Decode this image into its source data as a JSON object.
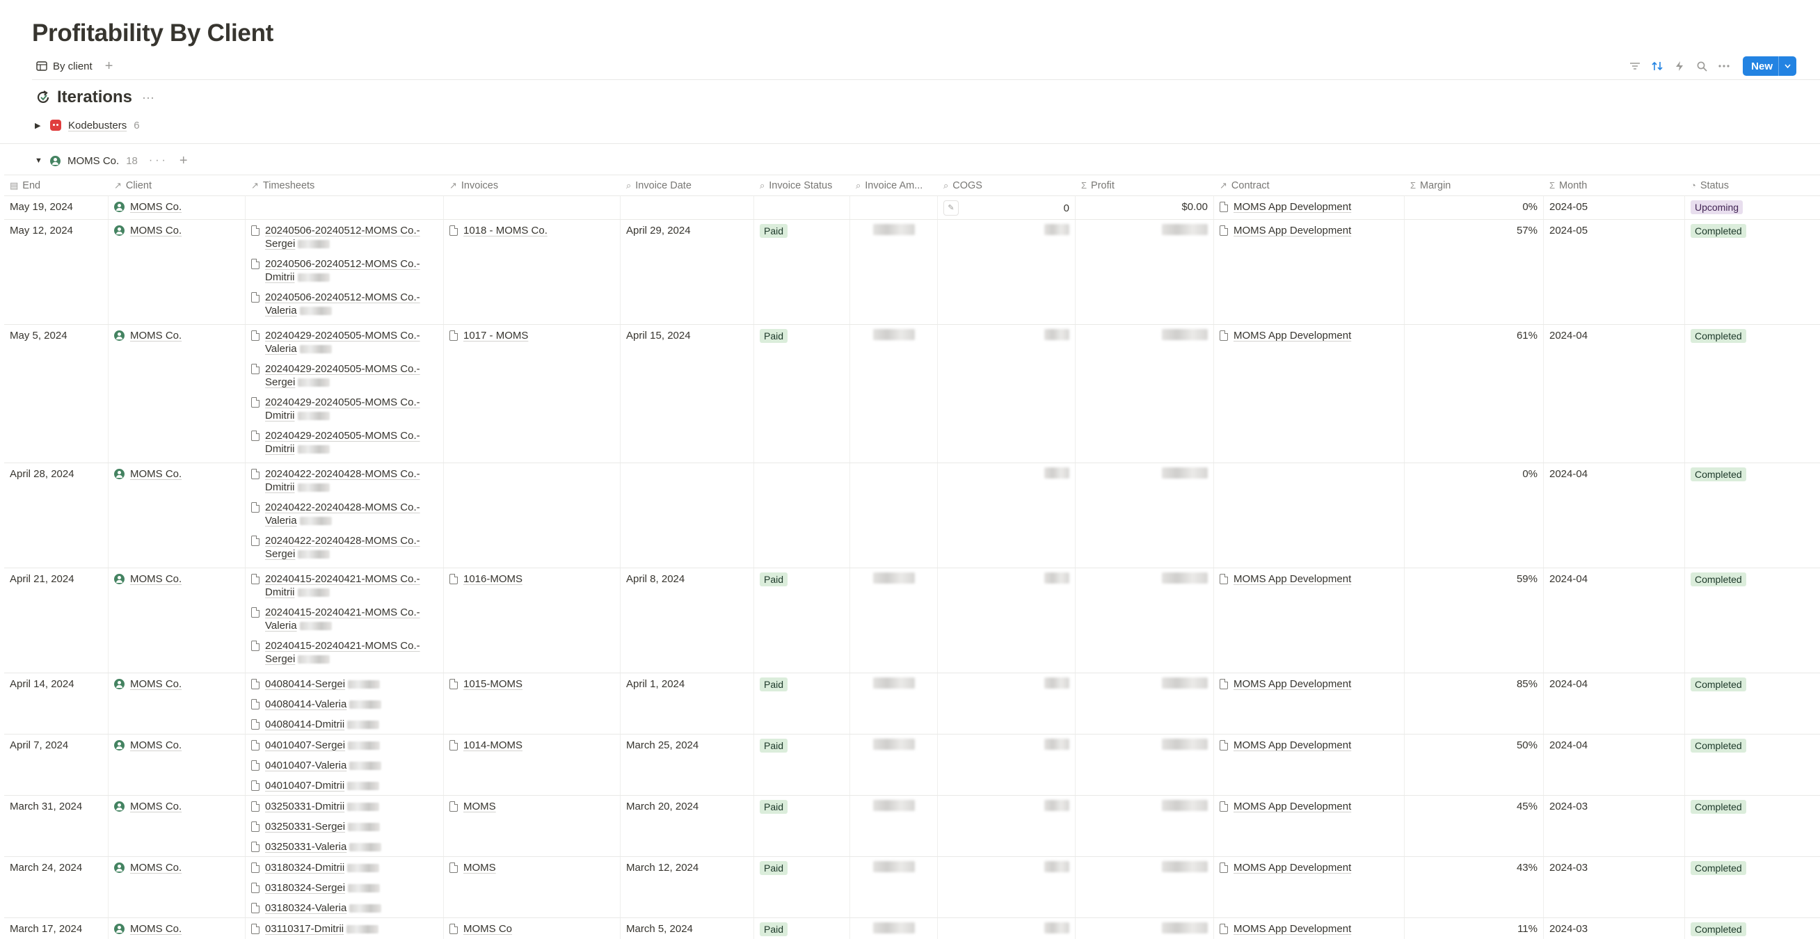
{
  "page": {
    "title": "Profitability By Client"
  },
  "viewbar": {
    "view_label": "By client",
    "add_label": "+"
  },
  "toolbar": {
    "new_label": "New"
  },
  "section": {
    "title": "Iterations",
    "more": "···"
  },
  "groups": [
    {
      "name": "Kodebusters",
      "count": "6",
      "expanded": false
    },
    {
      "name": "MOMS Co.",
      "count": "18",
      "expanded": true
    }
  ],
  "columns": [
    "End",
    "Client",
    "Timesheets",
    "Invoices",
    "Invoice Date",
    "Invoice Status",
    "Invoice Am...",
    "COGS",
    "Profit",
    "Contract",
    "Margin",
    "Month",
    "Status"
  ],
  "rows": [
    {
      "end": "May 19, 2024",
      "client": "MOMS Co.",
      "timesheets": [],
      "invoice": "",
      "invoice_date": "",
      "invoice_status": "",
      "cogs": "0",
      "profit": "$0.00",
      "contract": "MOMS App Development",
      "margin": "0%",
      "month": "2024-05",
      "status": "Upcoming"
    },
    {
      "end": "May 12, 2024",
      "client": "MOMS Co.",
      "timesheets": [
        [
          "20240506-20240512-MOMS Co.-",
          "Sergei"
        ],
        [
          "20240506-20240512-MOMS Co.-",
          "Dmitrii"
        ],
        [
          "20240506-20240512-MOMS Co.-",
          "Valeria"
        ]
      ],
      "invoice": "1018 - MOMS Co.",
      "invoice_date": "April 29, 2024",
      "invoice_status": "Paid",
      "cogs": "",
      "profit": "",
      "contract": "MOMS App Development",
      "margin": "57%",
      "month": "2024-05",
      "status": "Completed"
    },
    {
      "end": "May 5, 2024",
      "client": "MOMS Co.",
      "timesheets": [
        [
          "20240429-20240505-MOMS Co.-",
          "Valeria"
        ],
        [
          "20240429-20240505-MOMS Co.-",
          "Sergei"
        ],
        [
          "20240429-20240505-MOMS Co.-",
          "Dmitrii"
        ],
        [
          "20240429-20240505-MOMS Co.-",
          "Dmitrii"
        ]
      ],
      "invoice": "1017 - MOMS",
      "invoice_date": "April 15, 2024",
      "invoice_status": "Paid",
      "cogs": "",
      "profit": "",
      "contract": "MOMS App Development",
      "margin": "61%",
      "month": "2024-04",
      "status": "Completed"
    },
    {
      "end": "April 28, 2024",
      "client": "MOMS Co.",
      "timesheets": [
        [
          "20240422-20240428-MOMS Co.-",
          "Dmitrii"
        ],
        [
          "20240422-20240428-MOMS Co.-",
          "Valeria"
        ],
        [
          "20240422-20240428-MOMS Co.-",
          "Sergei"
        ]
      ],
      "invoice": "",
      "invoice_date": "",
      "invoice_status": "",
      "cogs": "",
      "profit": "",
      "contract": "",
      "margin": "0%",
      "month": "2024-04",
      "status": "Completed"
    },
    {
      "end": "April 21, 2024",
      "client": "MOMS Co.",
      "timesheets": [
        [
          "20240415-20240421-MOMS Co.-",
          "Dmitrii"
        ],
        [
          "20240415-20240421-MOMS Co.-",
          "Valeria"
        ],
        [
          "20240415-20240421-MOMS Co.-",
          "Sergei"
        ]
      ],
      "invoice": "1016-MOMS",
      "invoice_date": "April 8, 2024",
      "invoice_status": "Paid",
      "cogs": "",
      "profit": "",
      "contract": "MOMS App Development",
      "margin": "59%",
      "month": "2024-04",
      "status": "Completed"
    },
    {
      "end": "April 14, 2024",
      "client": "MOMS Co.",
      "timesheets": [
        [
          "04080414-Sergei",
          ""
        ],
        [
          "04080414-Valeria",
          ""
        ],
        [
          "04080414-Dmitrii",
          ""
        ]
      ],
      "invoice": "1015-MOMS",
      "invoice_date": "April 1, 2024",
      "invoice_status": "Paid",
      "cogs": "",
      "profit": "",
      "contract": "MOMS App Development",
      "margin": "85%",
      "month": "2024-04",
      "status": "Completed"
    },
    {
      "end": "April 7, 2024",
      "client": "MOMS Co.",
      "timesheets": [
        [
          "04010407-Sergei",
          ""
        ],
        [
          "04010407-Valeria",
          ""
        ],
        [
          "04010407-Dmitrii",
          ""
        ]
      ],
      "invoice": "1014-MOMS",
      "invoice_date": "March 25, 2024",
      "invoice_status": "Paid",
      "cogs": "",
      "profit": "",
      "contract": "MOMS App Development",
      "margin": "50%",
      "month": "2024-04",
      "status": "Completed"
    },
    {
      "end": "March 31, 2024",
      "client": "MOMS Co.",
      "timesheets": [
        [
          "03250331-Dmitrii",
          ""
        ],
        [
          "03250331-Sergei",
          ""
        ],
        [
          "03250331-Valeria",
          ""
        ]
      ],
      "invoice": "MOMS",
      "invoice_date": "March 20, 2024",
      "invoice_status": "Paid",
      "cogs": "",
      "profit": "",
      "contract": "MOMS App Development",
      "margin": "45%",
      "month": "2024-03",
      "status": "Completed"
    },
    {
      "end": "March 24, 2024",
      "client": "MOMS Co.",
      "timesheets": [
        [
          "03180324-Dmitrii",
          ""
        ],
        [
          "03180324-Sergei",
          ""
        ],
        [
          "03180324-Valeria",
          ""
        ]
      ],
      "invoice": "MOMS",
      "invoice_date": "March 12, 2024",
      "invoice_status": "Paid",
      "cogs": "",
      "profit": "",
      "contract": "MOMS App Development",
      "margin": "43%",
      "month": "2024-03",
      "status": "Completed"
    },
    {
      "end": "March 17, 2024",
      "client": "MOMS Co.",
      "timesheets": [
        [
          "03110317-Dmitrii",
          ""
        ]
      ],
      "invoice": "MOMS Co",
      "invoice_date": "March 5, 2024",
      "invoice_status": "Paid",
      "cogs": "",
      "profit": "",
      "contract": "MOMS App Development",
      "margin": "11%",
      "month": "2024-03",
      "status": "Completed"
    }
  ]
}
